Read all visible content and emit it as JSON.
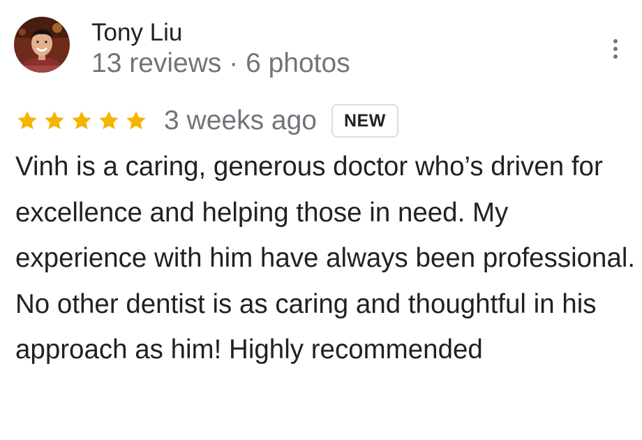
{
  "review": {
    "author": {
      "name": "Tony Liu",
      "meta": "13 reviews · 6 photos",
      "avatar_icon": "profile-photo"
    },
    "rating": {
      "stars": 5,
      "max_stars": 5,
      "star_color": "#f5b400"
    },
    "time_ago": "3 weeks ago",
    "badge": "NEW",
    "text": "Vinh is a caring, generous doctor who’s driven for excellence and helping those in need. My experience with him have always been professional. No other dentist is as caring and thoughtful in his approach as him! Highly recommended",
    "menu_icon": "more-vert-icon"
  }
}
